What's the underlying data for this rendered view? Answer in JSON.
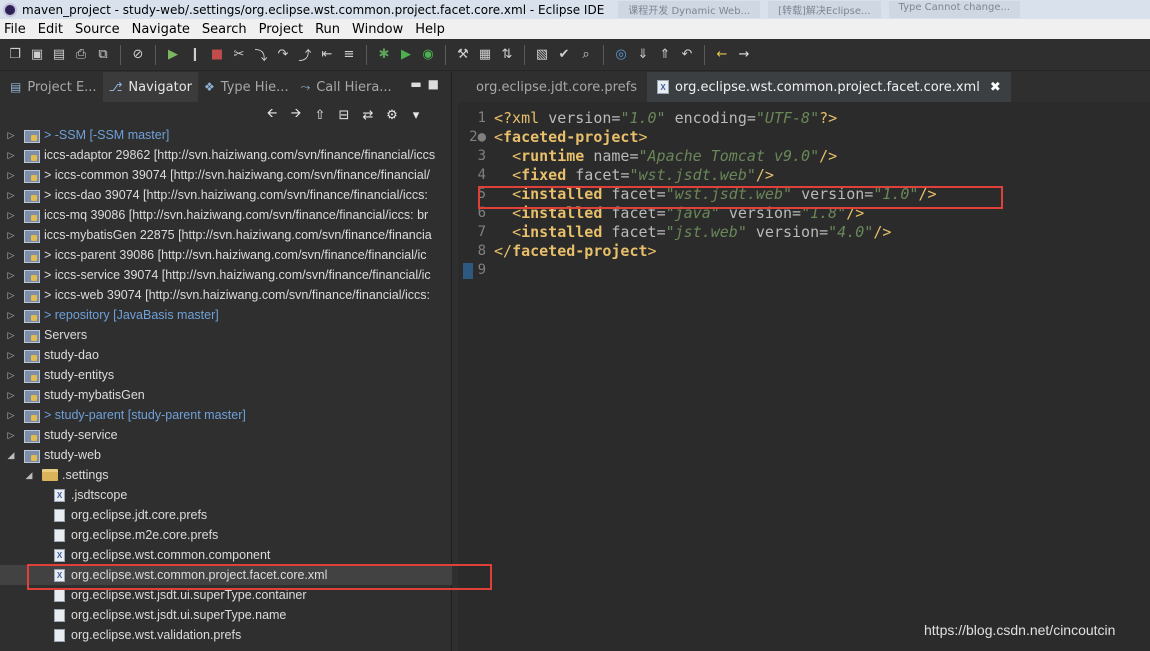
{
  "window": {
    "title": "maven_project - study-web/.settings/org.eclipse.wst.common.project.facet.core.xml - Eclipse IDE",
    "background_tabs": [
      "课程开发 Dynamic Web...",
      "[转载]解决Eclipse...",
      "Type Cannot change..."
    ]
  },
  "menu": [
    "File",
    "Edit",
    "Source",
    "Navigate",
    "Search",
    "Project",
    "Run",
    "Window",
    "Help"
  ],
  "toolbar_icons": [
    "new-icon",
    "save-icon",
    "save-all-icon",
    "print-icon",
    "link-icon",
    "skip-breakpoints-icon",
    "resume-icon",
    "suspend-icon",
    "terminate-icon",
    "disconnect-icon",
    "step-into-icon",
    "step-over-icon",
    "step-return-icon",
    "drop-frame-icon",
    "use-step-filters-icon",
    "debug-icon",
    "run-icon",
    "coverage-icon",
    "external-tools-icon",
    "new-server-icon",
    "publish-icon",
    "open-type-icon",
    "open-task-icon",
    "search-icon",
    "globe-icon",
    "next-annotation-icon",
    "previous-annotation-icon",
    "last-edit-icon",
    "back-icon",
    "forward-icon"
  ],
  "left_panel": {
    "tabs": [
      {
        "label": "Project E...",
        "active": false
      },
      {
        "label": "Navigator",
        "active": true
      },
      {
        "label": "Type Hie...",
        "active": false
      },
      {
        "label": "Call Hiera...",
        "active": false
      }
    ],
    "tree": [
      {
        "label": "> -SSM [-SSM master]",
        "type": "project",
        "git": true,
        "expanded": false
      },
      {
        "label": "iccs-adaptor 29862 [http://svn.haiziwang.com/svn/finance/financial/iccs",
        "type": "project",
        "git": false,
        "expanded": false
      },
      {
        "label": "> iccs-common 39074 [http://svn.haiziwang.com/svn/finance/financial/",
        "type": "project",
        "git": false,
        "expanded": false
      },
      {
        "label": "> iccs-dao 39074 [http://svn.haiziwang.com/svn/finance/financial/iccs:",
        "type": "project",
        "git": false,
        "expanded": false
      },
      {
        "label": "iccs-mq 39086 [http://svn.haiziwang.com/svn/finance/financial/iccs: br",
        "type": "project",
        "git": false,
        "expanded": false
      },
      {
        "label": "iccs-mybatisGen 22875 [http://svn.haiziwang.com/svn/finance/financia",
        "type": "project",
        "git": false,
        "expanded": false
      },
      {
        "label": "> iccs-parent 39086 [http://svn.haiziwang.com/svn/finance/financial/ic",
        "type": "project",
        "git": false,
        "expanded": false
      },
      {
        "label": "> iccs-service 39074 [http://svn.haiziwang.com/svn/finance/financial/ic",
        "type": "project",
        "git": false,
        "expanded": false
      },
      {
        "label": "> iccs-web 39074 [http://svn.haiziwang.com/svn/finance/financial/iccs:",
        "type": "project",
        "git": false,
        "expanded": false
      },
      {
        "label": "> repository [JavaBasis master]",
        "type": "project",
        "git": true,
        "expanded": false
      },
      {
        "label": "Servers",
        "type": "project",
        "git": false,
        "expanded": false
      },
      {
        "label": "study-dao",
        "type": "project",
        "git": false,
        "expanded": false
      },
      {
        "label": "study-entitys",
        "type": "project",
        "git": false,
        "expanded": false
      },
      {
        "label": "study-mybatisGen",
        "type": "project",
        "git": false,
        "expanded": false
      },
      {
        "label": "> study-parent [study-parent master]",
        "type": "project",
        "git": true,
        "expanded": false
      },
      {
        "label": "study-service",
        "type": "project",
        "git": false,
        "expanded": false
      },
      {
        "label": "study-web",
        "type": "project",
        "git": false,
        "expanded": true
      },
      {
        "label": ".settings",
        "type": "folder",
        "git": false,
        "expanded": true
      },
      {
        "label": ".jsdtscope",
        "type": "xml",
        "git": false
      },
      {
        "label": "org.eclipse.jdt.core.prefs",
        "type": "file",
        "git": false
      },
      {
        "label": "org.eclipse.m2e.core.prefs",
        "type": "file",
        "git": false
      },
      {
        "label": "org.eclipse.wst.common.component",
        "type": "xml",
        "git": false
      },
      {
        "label": "org.eclipse.wst.common.project.facet.core.xml",
        "type": "xml",
        "git": false,
        "selected": true
      },
      {
        "label": "org.eclipse.wst.jsdt.ui.superType.container",
        "type": "file",
        "git": false
      },
      {
        "label": "org.eclipse.wst.jsdt.ui.superType.name",
        "type": "file",
        "git": false
      },
      {
        "label": "org.eclipse.wst.validation.prefs",
        "type": "file",
        "git": false
      }
    ]
  },
  "editor": {
    "tabs": [
      {
        "label": "org.eclipse.jdt.core.prefs",
        "active": false
      },
      {
        "label": "org.eclipse.wst.common.project.facet.core.xml",
        "active": true
      }
    ],
    "lines": [
      {
        "n": "1",
        "html": "<span class='c-pi'>&lt;?xml</span> <span class='c-attr'>version</span><span class='c-eq'>=</span><span class='c-val'>\"1.0\"</span> <span class='c-attr'>encoding</span><span class='c-eq'>=</span><span class='c-val'>\"UTF-8\"</span><span class='c-pi'>?&gt;</span>"
      },
      {
        "n": "2●",
        "html": "<span class='c-punct'>&lt;</span><span class='c-tag'>faceted-project</span><span class='c-punct'>&gt;</span>"
      },
      {
        "n": "3",
        "html": "  <span class='c-punct'>&lt;</span><span class='c-tag'>runtime</span> <span class='c-attr'>name</span><span class='c-eq'>=</span><span class='c-val'>\"Apache Tomcat v9.0\"</span><span class='c-punct'>/&gt;</span>"
      },
      {
        "n": "4",
        "html": "  <span class='c-punct'>&lt;</span><span class='c-tag'>fixed</span> <span class='c-attr'>facet</span><span class='c-eq'>=</span><span class='c-val'>\"wst.jsdt.web\"</span><span class='c-punct'>/&gt;</span>"
      },
      {
        "n": "5",
        "html": "  <span class='c-punct'>&lt;</span><span class='c-tag'>installed</span> <span class='c-attr'>facet</span><span class='c-eq'>=</span><span class='c-val'>\"wst.jsdt.web\"</span> <span class='c-attr'>version</span><span class='c-eq'>=</span><span class='c-val'>\"1.0\"</span><span class='c-punct'>/&gt;</span>"
      },
      {
        "n": "6",
        "html": "  <span class='c-punct'>&lt;</span><span class='c-tag'>installed</span> <span class='c-attr'>facet</span><span class='c-eq'>=</span><span class='c-val'>\"java\"</span> <span class='c-attr'>version</span><span class='c-eq'>=</span><span class='c-val'>\"1.8\"</span><span class='c-punct'>/&gt;</span>"
      },
      {
        "n": "7",
        "html": "  <span class='c-punct'>&lt;</span><span class='c-tag'>installed</span> <span class='c-attr'>facet</span><span class='c-eq'>=</span><span class='c-val'>\"jst.web\"</span> <span class='c-attr'>version</span><span class='c-eq'>=</span><span class='c-val'>\"4.0\"</span><span class='c-punct'>/&gt;</span>"
      },
      {
        "n": "8",
        "html": "<span class='c-punct'>&lt;/</span><span class='c-tag'>faceted-project</span><span class='c-punct'>&gt;</span>"
      },
      {
        "n": "9",
        "html": ""
      }
    ]
  },
  "watermark": "https://blog.csdn.net/cincoutcin"
}
